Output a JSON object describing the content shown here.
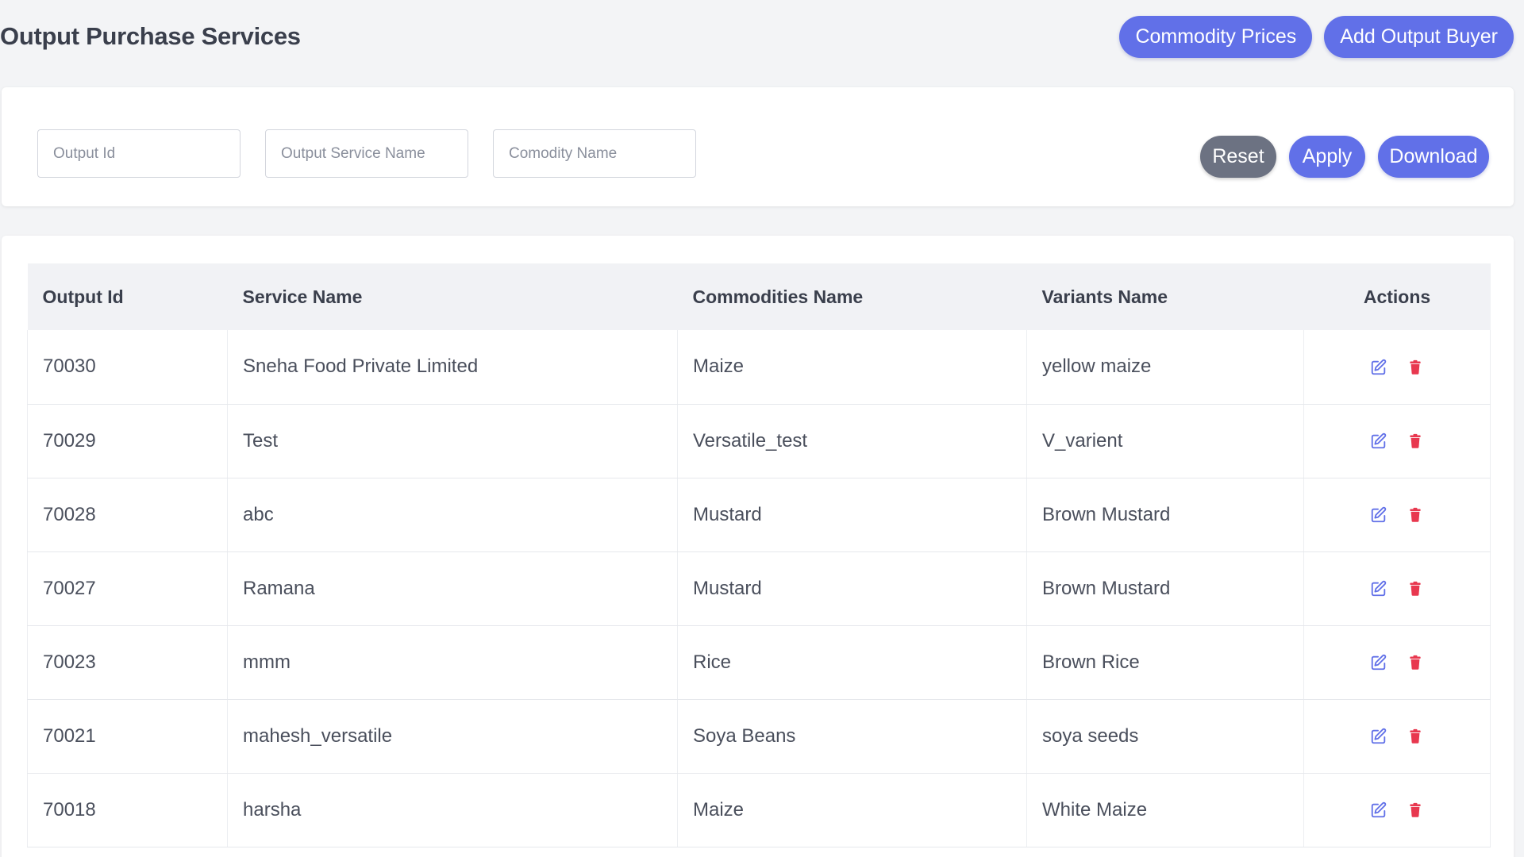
{
  "header": {
    "title": "Output Purchase Services",
    "commodity_prices_label": "Commodity Prices",
    "add_output_buyer_label": "Add Output Buyer"
  },
  "filters": {
    "output_id_placeholder": "Output Id",
    "service_name_placeholder": "Output Service Name",
    "commodity_name_placeholder": "Comodity Name",
    "reset_label": "Reset",
    "apply_label": "Apply",
    "download_label": "Download"
  },
  "table": {
    "columns": [
      "Output Id",
      "Service Name",
      "Commodities Name",
      "Variants Name",
      "Actions"
    ],
    "rows": [
      {
        "id": "70030",
        "service": "Sneha Food Private Limited",
        "commodity": "Maize",
        "variant": "yellow maize"
      },
      {
        "id": "70029",
        "service": "Test",
        "commodity": "Versatile_test",
        "variant": "V_varient"
      },
      {
        "id": "70028",
        "service": "abc",
        "commodity": "Mustard",
        "variant": "Brown Mustard"
      },
      {
        "id": "70027",
        "service": "Ramana",
        "commodity": "Mustard",
        "variant": "Brown Mustard"
      },
      {
        "id": "70023",
        "service": "mmm",
        "commodity": "Rice",
        "variant": "Brown Rice"
      },
      {
        "id": "70021",
        "service": "mahesh_versatile",
        "commodity": "Soya Beans",
        "variant": "soya seeds"
      },
      {
        "id": "70018",
        "service": "harsha",
        "commodity": "Maize",
        "variant": "White Maize"
      }
    ],
    "edit_icon": "edit-icon",
    "delete_icon": "trash-icon"
  },
  "colors": {
    "primary": "#6170e8",
    "reset": "#6c7282",
    "delete": "#e8384f",
    "background": "#f3f4f6"
  }
}
